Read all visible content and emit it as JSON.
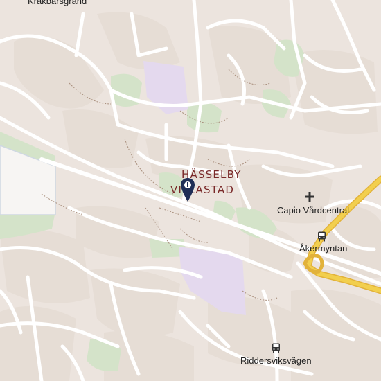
{
  "map": {
    "colors": {
      "background": "#efe9e4",
      "block": "#e6dcd4",
      "street": "#ffffff",
      "park": "#d4e3c9",
      "institution": "#e4d9ee",
      "highway": "#f2cf4e",
      "highway_edge": "#e2b23a",
      "path": "#a98f7d",
      "label": "#222222",
      "district_label": "#7a2a2a",
      "pin": "#1f2e56"
    },
    "labels": {
      "street_top": "Krakbärsgränd",
      "district_line1": "HÄSSELBY",
      "district_line2": "VILLASTAD",
      "clinic": "Capio Vårdcentral",
      "bus_stop_1": "Åkermyntan",
      "bus_stop_2": "Riddersviksvägen"
    },
    "icons": {
      "clinic": "medical-cross-icon",
      "bus_stop_1": "bus-icon",
      "bus_stop_2": "bus-icon",
      "marker": "location-pin-icon"
    }
  }
}
